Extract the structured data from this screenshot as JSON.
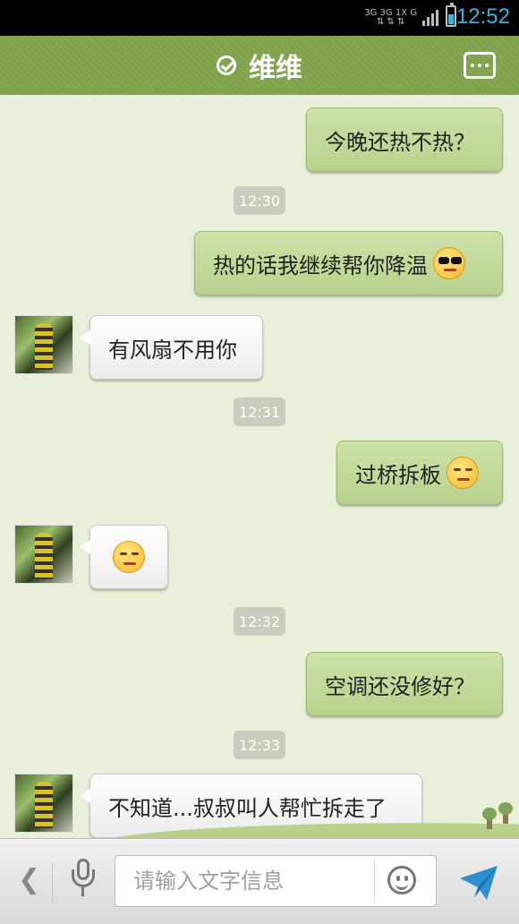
{
  "status_bar": {
    "network_top": "3G 3G 1X G",
    "time": "12:52"
  },
  "header": {
    "title": "维维",
    "verified_icon": "check-circle-icon",
    "menu_icon": "more-dots-icon"
  },
  "messages": [
    {
      "type": "out",
      "text": "今晚还热不热？"
    },
    {
      "type": "timestamp",
      "text": "12:30"
    },
    {
      "type": "out",
      "text": "热的话我继续帮你降温",
      "emoji": "cool-sunglasses-emoji"
    },
    {
      "type": "in",
      "text": "有风扇不用你"
    },
    {
      "type": "timestamp",
      "text": "12:31"
    },
    {
      "type": "out",
      "text": "过桥拆板",
      "emoji": "smug-emoji"
    },
    {
      "type": "in",
      "text": "",
      "emoji": "smirk-emoji"
    },
    {
      "type": "timestamp",
      "text": "12:32"
    },
    {
      "type": "out",
      "text": "空调还没修好？"
    },
    {
      "type": "timestamp",
      "text": "12:33"
    },
    {
      "type": "in",
      "text": "不知道...叔叔叫人帮忙拆走了"
    }
  ],
  "input_bar": {
    "placeholder": "请输入文字信息",
    "back_icon": "chevron-left-icon",
    "voice_icon": "microphone-icon",
    "emoji_icon": "smiley-icon",
    "send_icon": "send-plane-icon"
  },
  "colors": {
    "header_green": "#7fa24a",
    "out_bubble": "#c4db9b",
    "status_time": "#33b5e5"
  }
}
